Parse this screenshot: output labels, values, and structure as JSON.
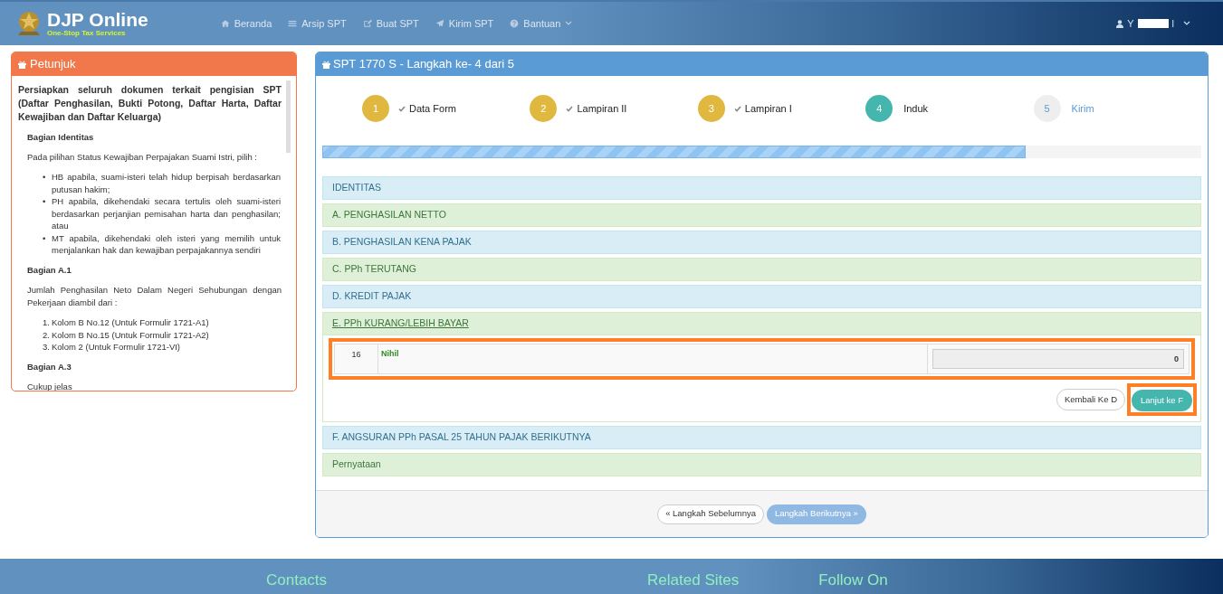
{
  "header": {
    "brand": "DJP Online",
    "tagline": "One-Stop Tax Services",
    "nav": [
      {
        "label": "Beranda",
        "dropdown": false
      },
      {
        "label": "Arsip SPT",
        "dropdown": false
      },
      {
        "label": "Buat SPT",
        "dropdown": false
      },
      {
        "label": "Kirim SPT",
        "dropdown": false
      },
      {
        "label": "Bantuan",
        "dropdown": true
      }
    ],
    "user": {
      "initial": "Y",
      "tail": "l"
    }
  },
  "sidebar": {
    "title": "Petunjuk",
    "intro": "Persiapkan seluruh dokumen terkait pengisian SPT (Daftar Penghasilan, Bukti Potong, Daftar Harta, Daftar Kewajiban dan Daftar Keluarga)",
    "sections": [
      {
        "heading": "Bagian Identitas",
        "text": "Pada pilihan Status Kewajiban Perpajakan Suami Istri, pilih :",
        "items": [
          {
            "marker": "•",
            "text": "HB apabila, suami-isteri telah hidup berpisah berdasarkan putusan hakim;"
          },
          {
            "marker": "•",
            "text": "PH apabila, dikehendaki secara tertulis oleh suami-isteri berdasarkan perjanjian pemisahan harta dan penghasilan; atau"
          },
          {
            "marker": "•",
            "text": "MT apabila, dikehendaki oleh isteri yang memilih untuk menjalankan hak dan kewajiban perpajakannya sendiri"
          }
        ]
      },
      {
        "heading": "Bagian A.1",
        "text": "Jumlah Penghasilan Neto Dalam Negeri Sehubungan dengan Pekerjaan diambil dari :",
        "items": [
          {
            "marker": "1.",
            "text": "Kolom B No.12 (Untuk Formulir 1721-A1)"
          },
          {
            "marker": "2.",
            "text": "Kolom B No.15 (Untuk Formulir 1721-A2)"
          },
          {
            "marker": "3.",
            "text": "Kolom 2 (Untuk Formulir 1721-VI)"
          }
        ]
      },
      {
        "heading": "Bagian A.3",
        "text": "Cukup jelas"
      }
    ]
  },
  "main": {
    "title": "SPT 1770 S - Langkah ke- 4 dari 5",
    "steps": [
      {
        "number": "1",
        "label": "Data Form",
        "done": true,
        "selected": false
      },
      {
        "number": "2",
        "label": "Lampiran II",
        "done": true,
        "selected": false
      },
      {
        "number": "3",
        "label": "Lampiran I",
        "done": true,
        "selected": false
      },
      {
        "number": "4",
        "label": "Induk",
        "done": false,
        "selected": true
      },
      {
        "number": "5",
        "label": "Kirim",
        "done": false,
        "selected": false
      }
    ],
    "progress": {
      "level": 0.8
    },
    "sections": [
      {
        "title": "IDENTITAS",
        "kind": "info",
        "expanded": false
      },
      {
        "title": "A. PENGHASILAN NETTO",
        "kind": "success",
        "expanded": false
      },
      {
        "title": "B. PENGHASILAN KENA PAJAK",
        "kind": "info",
        "expanded": false
      },
      {
        "title": "C. PPh TERUTANG",
        "kind": "success",
        "expanded": false
      },
      {
        "title": "D. KREDIT PAJAK",
        "kind": "info",
        "expanded": false
      },
      {
        "title": "E. PPh KURANG/LEBIH BAYAR",
        "kind": "success",
        "expanded": true,
        "row": {
          "number": "16",
          "label": "Nihil",
          "value": "0"
        },
        "back_button": "Kembali Ke D",
        "next_button": "Lanjut ke F"
      },
      {
        "title": "F. ANGSURAN PPh PASAL 25 TAHUN PAJAK BERIKUTNYA",
        "kind": "info",
        "expanded": false
      },
      {
        "title": "Pernyataan",
        "kind": "success",
        "expanded": false
      }
    ],
    "prev_button": "« Langkah Sebelumnya",
    "next_button": "Langkah Berikutnya »"
  },
  "footer": {
    "headings": [
      "Contacts",
      "Related Sites",
      "Follow On"
    ]
  }
}
